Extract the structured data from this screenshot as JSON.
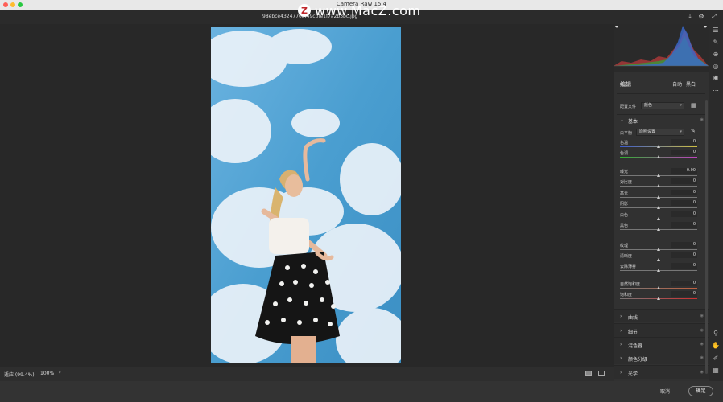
{
  "app": {
    "title": "Camera Raw 15.4"
  },
  "watermark": {
    "logo_letter": "Z",
    "text": "www.MacZ.com"
  },
  "file": {
    "name": "98ebce4324770af49cbfe1f7a2b3bc.jpg"
  },
  "top_icons": [
    "save-icon",
    "gear-icon",
    "fullscreen-icon"
  ],
  "canvas_bar": {
    "zoom_fit": "适应 (99.4%)",
    "zoom_100": "100%"
  },
  "footer": {
    "cancel": "取消",
    "ok": "确定"
  },
  "edit": {
    "title": "编辑",
    "auto": "自动",
    "bw": "黑白"
  },
  "profile": {
    "label": "配置文件",
    "value": "颜色"
  },
  "basic": {
    "title": "基本",
    "wb_label": "白平衡",
    "wb_value": "原照设置",
    "sliders": [
      {
        "name": "色温",
        "value": "0",
        "pos": 0.5
      },
      {
        "name": "色调",
        "value": "0",
        "pos": 0.5
      },
      {
        "name": "曝光",
        "value": "0.00",
        "pos": 0.5
      },
      {
        "name": "对比度",
        "value": "0",
        "pos": 0.5
      },
      {
        "name": "高光",
        "value": "0",
        "pos": 0.5
      },
      {
        "name": "阴影",
        "value": "0",
        "pos": 0.5
      },
      {
        "name": "白色",
        "value": "0",
        "pos": 0.5
      },
      {
        "name": "黑色",
        "value": "0",
        "pos": 0.5
      },
      {
        "name": "纹理",
        "value": "0",
        "pos": 0.5
      },
      {
        "name": "清晰度",
        "value": "0",
        "pos": 0.5
      },
      {
        "name": "去除薄雾",
        "value": "0",
        "pos": 0.5
      },
      {
        "name": "自然饱和度",
        "value": "0",
        "pos": 0.5
      },
      {
        "name": "饱和度",
        "value": "0",
        "pos": 0.5
      }
    ]
  },
  "sections": [
    "曲线",
    "细节",
    "混色器",
    "颜色分级",
    "光学"
  ],
  "colors": {
    "panel": "#313131",
    "canvas": "#282828",
    "sky": "#4a9ed0"
  }
}
